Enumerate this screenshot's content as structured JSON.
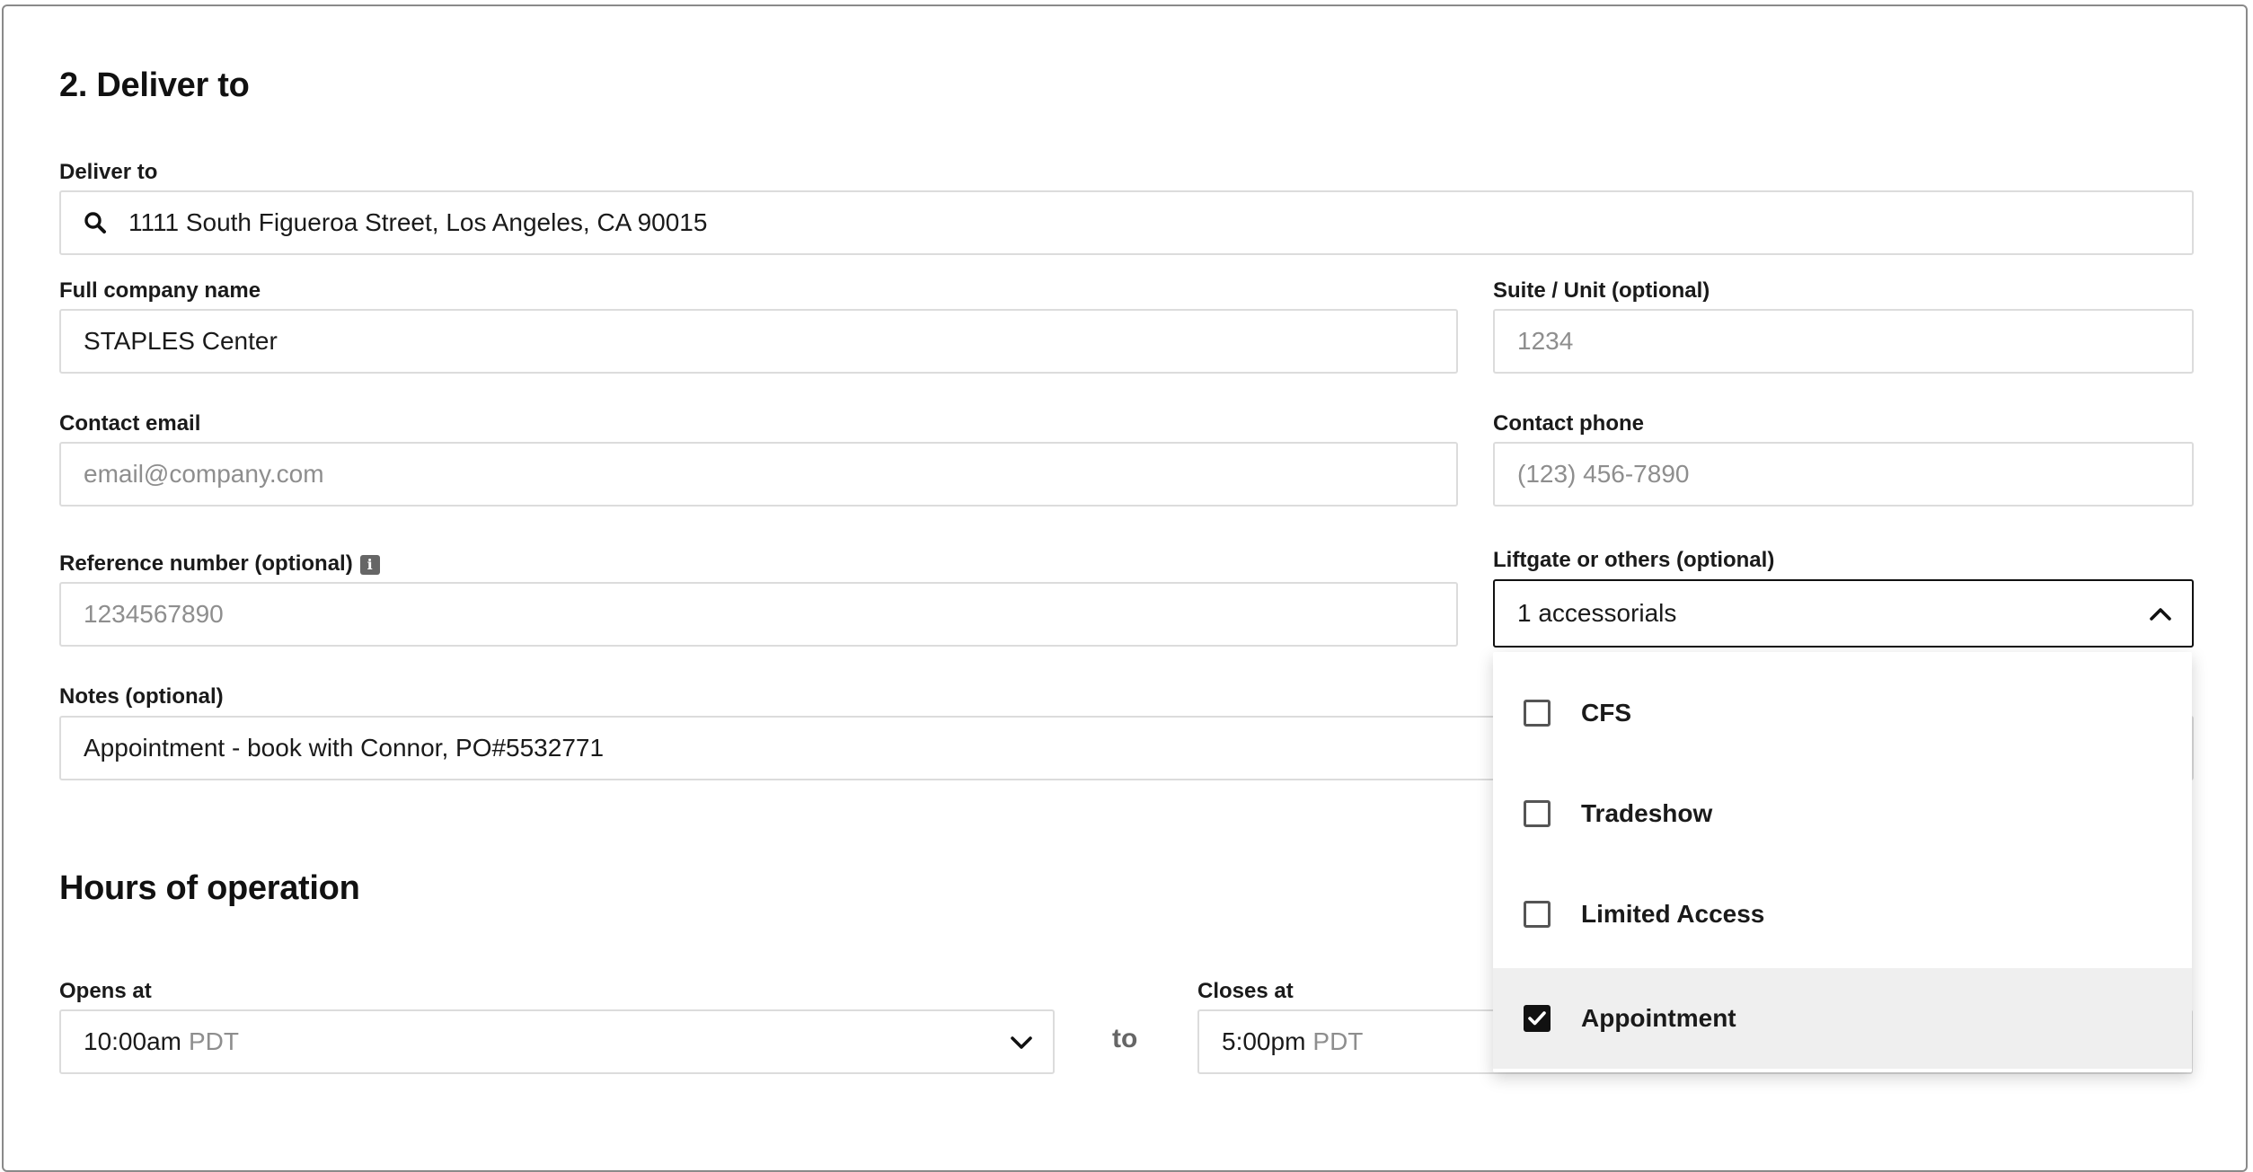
{
  "section": {
    "title": "2. Deliver to"
  },
  "deliver_to": {
    "label": "Deliver to",
    "value": "1111 South Figueroa Street, Los Angeles, CA 90015"
  },
  "company": {
    "label": "Full company name",
    "value": "STAPLES Center"
  },
  "suite": {
    "label": "Suite / Unit (optional)",
    "placeholder": "1234"
  },
  "email": {
    "label": "Contact email",
    "placeholder": "email@company.com"
  },
  "phone": {
    "label": "Contact phone",
    "placeholder": "(123) 456-7890"
  },
  "reference": {
    "label": "Reference number (optional)",
    "placeholder": "1234567890",
    "info_icon": "info-icon"
  },
  "accessorials": {
    "label": "Liftgate or others (optional)",
    "value": "1 accessorials",
    "options": [
      {
        "label": "CFS",
        "checked": false
      },
      {
        "label": "Tradeshow",
        "checked": false
      },
      {
        "label": "Limited Access",
        "checked": false
      },
      {
        "label": "Appointment",
        "checked": true
      }
    ]
  },
  "notes": {
    "label": "Notes (optional)",
    "value": "Appointment - book with Connor, PO#5532771"
  },
  "hours": {
    "title": "Hours of operation",
    "opens_label": "Opens at",
    "opens_time": "10:00am",
    "opens_tz": "PDT",
    "to": "to",
    "closes_label": "Closes at",
    "closes_time": "5:00pm",
    "closes_tz": "PDT"
  },
  "colors": {
    "border": "#dcdcdc",
    "active_border": "#111111",
    "placeholder": "#8e8e8e",
    "selected_option_bg": "#efefef"
  }
}
